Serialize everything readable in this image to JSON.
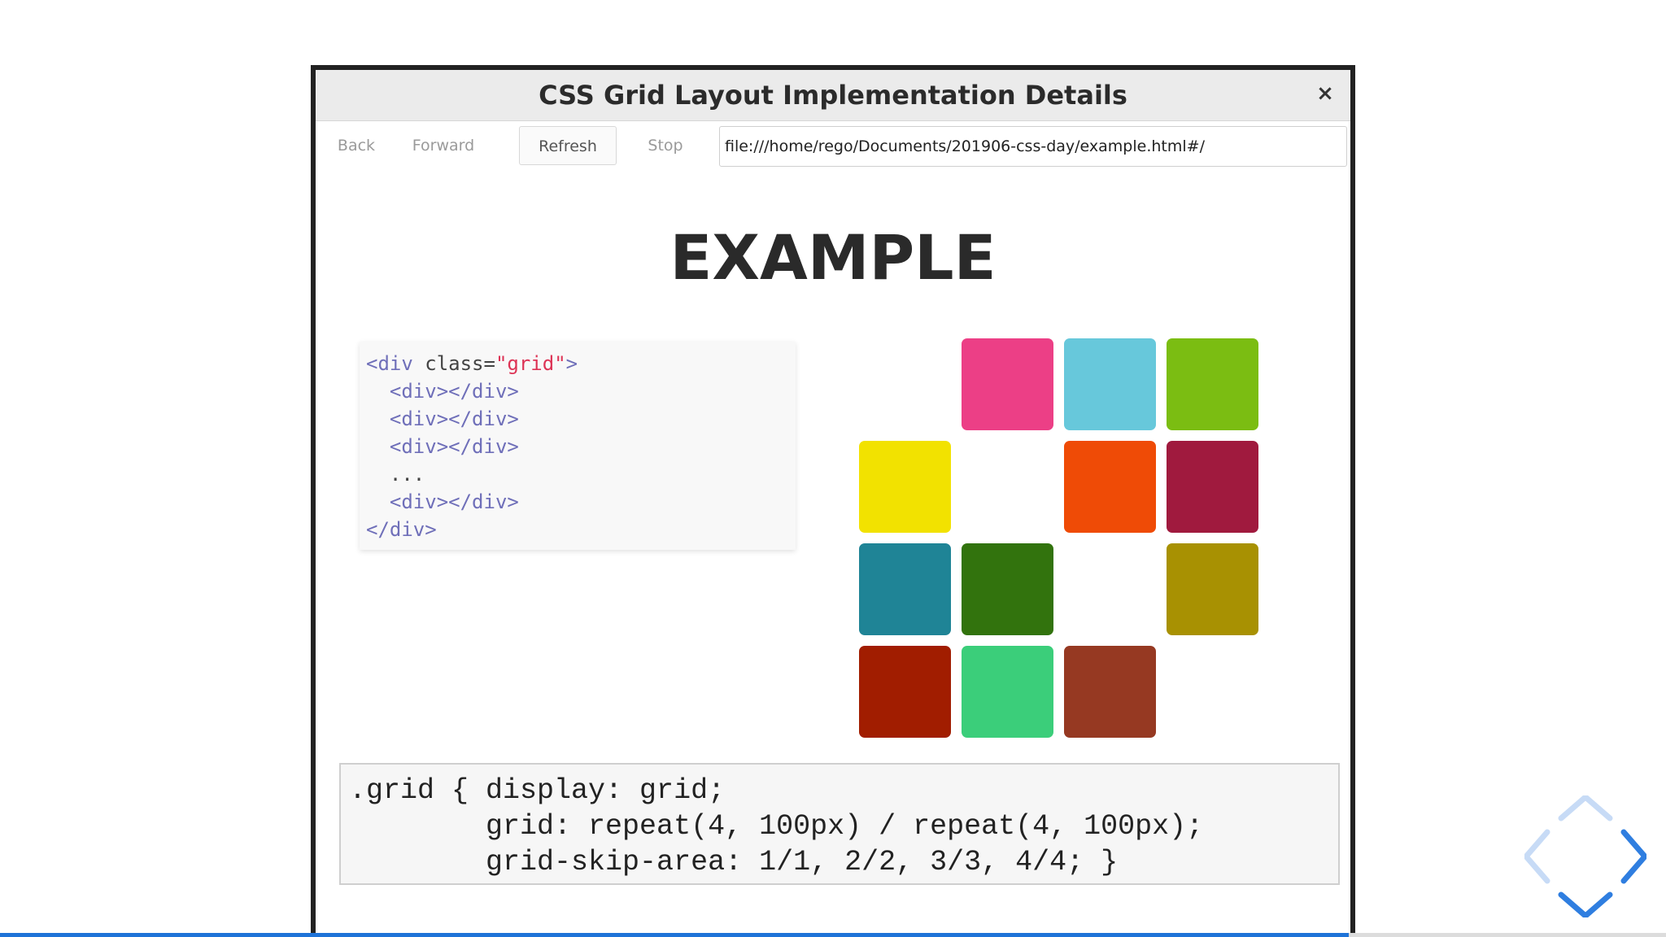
{
  "window": {
    "title": "CSS Grid Layout Implementation Details",
    "close_glyph": "×"
  },
  "toolbar": {
    "back_label": "Back",
    "forward_label": "Forward",
    "refresh_label": "Refresh",
    "stop_label": "Stop",
    "url_value": "file:///home/rego/Documents/201906-css-day/example.html#/"
  },
  "page": {
    "heading": "EXAMPLE"
  },
  "html_code": {
    "line1": {
      "open": "<div ",
      "attr": "class=",
      "value": "\"grid\"",
      "close": ">"
    },
    "line2": "  <div></div>",
    "line3": "  <div></div>",
    "line4": "  <div></div>",
    "line5": "  ...",
    "line6": "  <div></div>",
    "line7": "</div>"
  },
  "css_code": {
    "line1": ".grid { display: grid;",
    "line2": "        grid: repeat(4, 100px) / repeat(4, 100px);",
    "line3": "        grid-skip-area: 1/1, 2/2, 3/3, 4/4; }"
  },
  "grid_tiles": [
    {
      "row": 1,
      "col": 2,
      "color": "#ec3f86"
    },
    {
      "row": 1,
      "col": 3,
      "color": "#67c8db"
    },
    {
      "row": 1,
      "col": 4,
      "color": "#7bbd12"
    },
    {
      "row": 2,
      "col": 1,
      "color": "#f2e200"
    },
    {
      "row": 2,
      "col": 3,
      "color": "#ef4b06"
    },
    {
      "row": 2,
      "col": 4,
      "color": "#a01a3e"
    },
    {
      "row": 3,
      "col": 1,
      "color": "#1f8496"
    },
    {
      "row": 3,
      "col": 2,
      "color": "#32730d"
    },
    {
      "row": 3,
      "col": 4,
      "color": "#a89102"
    },
    {
      "row": 4,
      "col": 1,
      "color": "#a11d00"
    },
    {
      "row": 4,
      "col": 2,
      "color": "#3bce7a"
    },
    {
      "row": 4,
      "col": 3,
      "color": "#963922"
    }
  ],
  "colors": {
    "accent": "#1e73d8",
    "nav_arrow_active": "#2f7ee0",
    "nav_arrow_dim": "#c7dbf6"
  },
  "icons": {
    "close": "close-icon",
    "nav_up": "chevron-up-icon",
    "nav_left": "chevron-left-icon",
    "nav_right": "chevron-right-icon",
    "nav_down": "chevron-down-icon"
  }
}
